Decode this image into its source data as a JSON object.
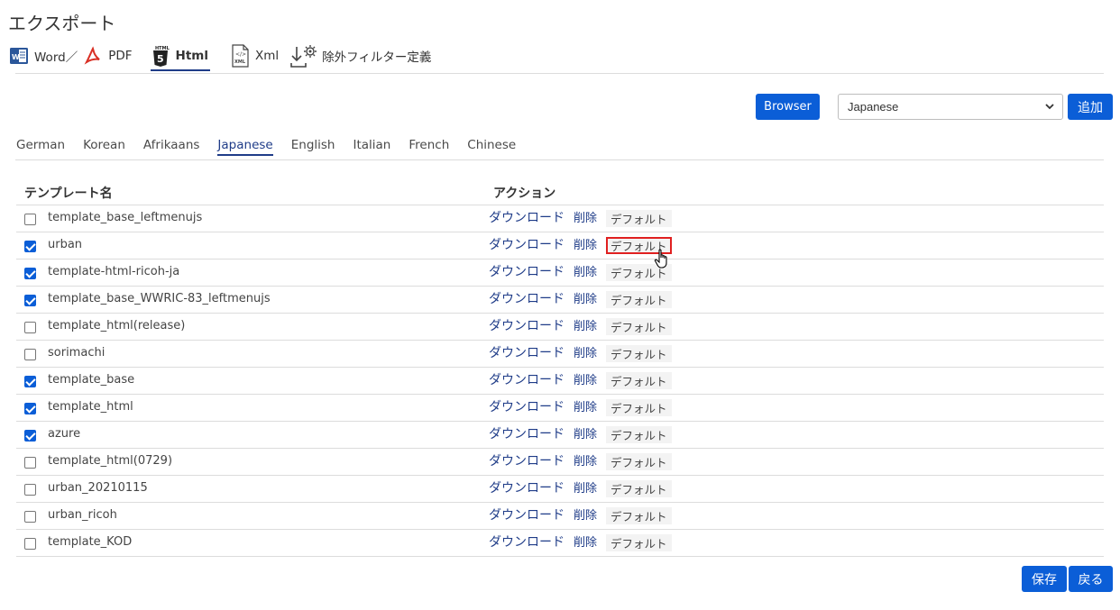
{
  "page": {
    "title": "エクスポート"
  },
  "format_tabs": [
    {
      "label": "Word／",
      "icon": "word-icon",
      "active": false
    },
    {
      "label": "PDF",
      "icon": "pdf-icon",
      "active": false
    },
    {
      "label": "Html",
      "icon": "html5-icon",
      "active": true
    },
    {
      "label": "Xml",
      "icon": "xml-icon",
      "active": false
    },
    {
      "label": "除外フィルター定義",
      "icon": "filter-settings-icon",
      "active": false
    }
  ],
  "toolbar": {
    "browser_label": "Browser",
    "language_value": "Japanese",
    "add_label": "追加"
  },
  "language_tabs": [
    {
      "label": "German",
      "active": false
    },
    {
      "label": "Korean",
      "active": false
    },
    {
      "label": "Afrikaans",
      "active": false
    },
    {
      "label": "Japanese",
      "active": true
    },
    {
      "label": "English",
      "active": false
    },
    {
      "label": "Italian",
      "active": false
    },
    {
      "label": "French",
      "active": false
    },
    {
      "label": "Chinese",
      "active": false
    }
  ],
  "table": {
    "col_name": "テンプレート名",
    "col_action": "アクション",
    "action_download": "ダウンロード",
    "action_delete": "削除",
    "action_default": "デフォルト",
    "rows": [
      {
        "name": "template_base_leftmenujs",
        "checked": false
      },
      {
        "name": "urban",
        "checked": true,
        "highlight_default": true
      },
      {
        "name": "template-html-ricoh-ja",
        "checked": true
      },
      {
        "name": "template_base_WWRIC-83_leftmenujs",
        "checked": true
      },
      {
        "name": "template_html(release)",
        "checked": false
      },
      {
        "name": "sorimachi",
        "checked": false
      },
      {
        "name": "template_base",
        "checked": true
      },
      {
        "name": "template_html",
        "checked": true
      },
      {
        "name": "azure",
        "checked": true
      },
      {
        "name": "template_html(0729)",
        "checked": false
      },
      {
        "name": "urban_20210115",
        "checked": false
      },
      {
        "name": "urban_ricoh",
        "checked": false
      },
      {
        "name": "template_KOD",
        "checked": false
      }
    ]
  },
  "footer": {
    "save_label": "保存",
    "back_label": "戻る"
  },
  "colors": {
    "primary": "#0b5ed7",
    "accent_text": "#1f3c88",
    "highlight": "#e02020"
  }
}
